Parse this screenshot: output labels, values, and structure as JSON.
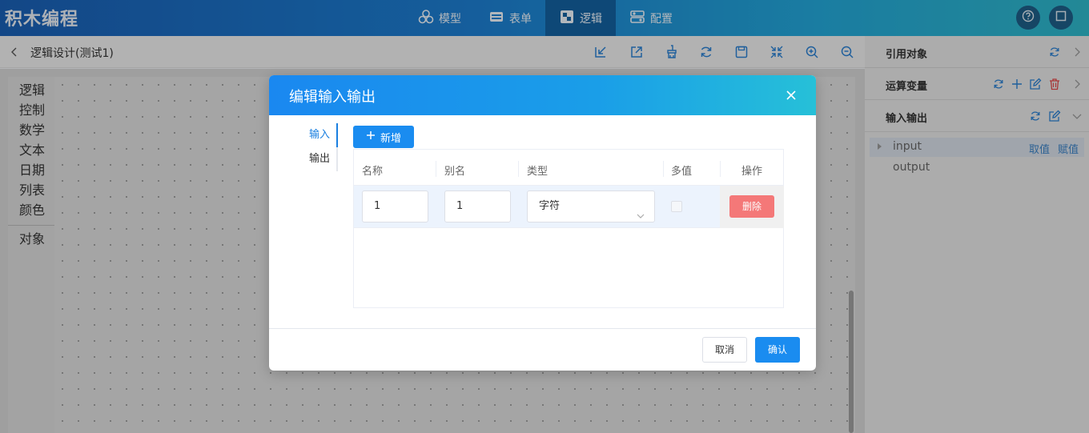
{
  "app": {
    "brand": "积木编程"
  },
  "nav": {
    "items": [
      {
        "label": "模型",
        "icon": "model-icon",
        "active": false
      },
      {
        "label": "表单",
        "icon": "form-icon",
        "active": false
      },
      {
        "label": "逻辑",
        "icon": "logic-icon",
        "active": true
      },
      {
        "label": "配置",
        "icon": "config-icon",
        "active": false
      }
    ]
  },
  "header_buttons": [
    "help-icon",
    "fullscreen-icon"
  ],
  "subbar": {
    "title": "逻辑设计(测试1)",
    "tools": [
      "import-icon",
      "export-icon",
      "clean-icon",
      "refresh-icon",
      "save-icon",
      "collapse-icon",
      "zoom-in-icon",
      "zoom-out-icon"
    ]
  },
  "categories": [
    "逻辑",
    "控制",
    "数学",
    "文本",
    "日期",
    "列表",
    "颜色",
    "对象"
  ],
  "right_panel": {
    "sections": [
      {
        "title": "引用对象"
      },
      {
        "title": "运算变量"
      },
      {
        "title": "输入输出"
      }
    ],
    "io_items": [
      {
        "label": "input",
        "actions": [
          "取值",
          "赋值"
        ]
      },
      {
        "label": "output"
      }
    ]
  },
  "dialog": {
    "title": "编辑输入输出",
    "tabs": [
      "输入",
      "输出"
    ],
    "active_tab": "输入",
    "add_label": "新增",
    "columns": [
      "名称",
      "别名",
      "类型",
      "多值",
      "操作"
    ],
    "rows": [
      {
        "name": "1",
        "alias": "1",
        "type": "字符",
        "multi": false,
        "action": "删除"
      }
    ],
    "cancel_label": "取消",
    "confirm_label": "确认"
  },
  "colors": {
    "primary": "#1a8cf0",
    "danger": "#f56c6c",
    "header_start": "#1a5fb4",
    "header_end": "#2fb7c9"
  }
}
